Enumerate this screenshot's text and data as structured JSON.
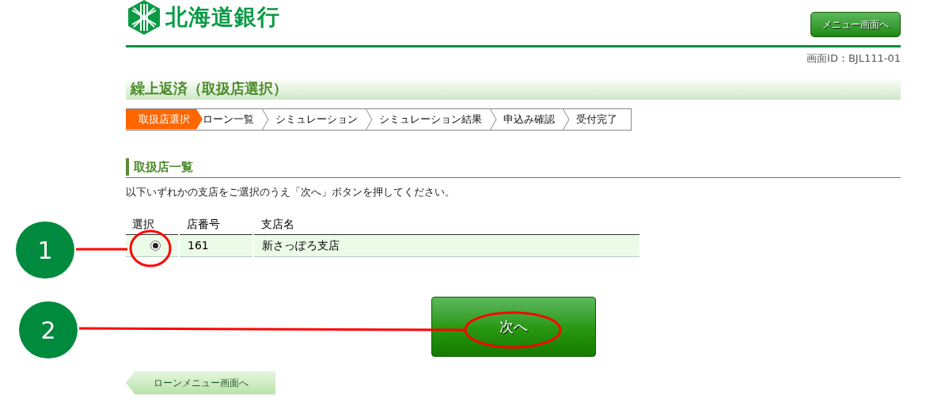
{
  "header": {
    "logo_text": "北海道銀行",
    "menu_button": "メニュー画面へ",
    "screen_id": "画面ID：BJL111-01"
  },
  "page_title": "繰上返済（取扱店選択）",
  "steps": [
    {
      "label": "取扱店選択",
      "selected": true
    },
    {
      "label": "ローン一覧",
      "selected": false
    },
    {
      "label": "シミュレーション",
      "selected": false
    },
    {
      "label": "シミュレーション結果",
      "selected": false
    },
    {
      "label": "申込み確認",
      "selected": false
    },
    {
      "label": "受付完了",
      "selected": false
    }
  ],
  "section_title": "取扱店一覧",
  "instruction": "以下いずれかの支店をご選択のうえ「次へ」ボタンを押してください。",
  "table": {
    "columns": [
      "選択",
      "店番号",
      "支店名"
    ],
    "rows": [
      {
        "selected": true,
        "cells": [
          "",
          "161",
          "新さっぽろ支店"
        ]
      }
    ]
  },
  "next_button": "次へ",
  "back_button": "ローンメニュー画面へ",
  "annotations": [
    {
      "label": "1"
    },
    {
      "label": "2"
    }
  ]
}
